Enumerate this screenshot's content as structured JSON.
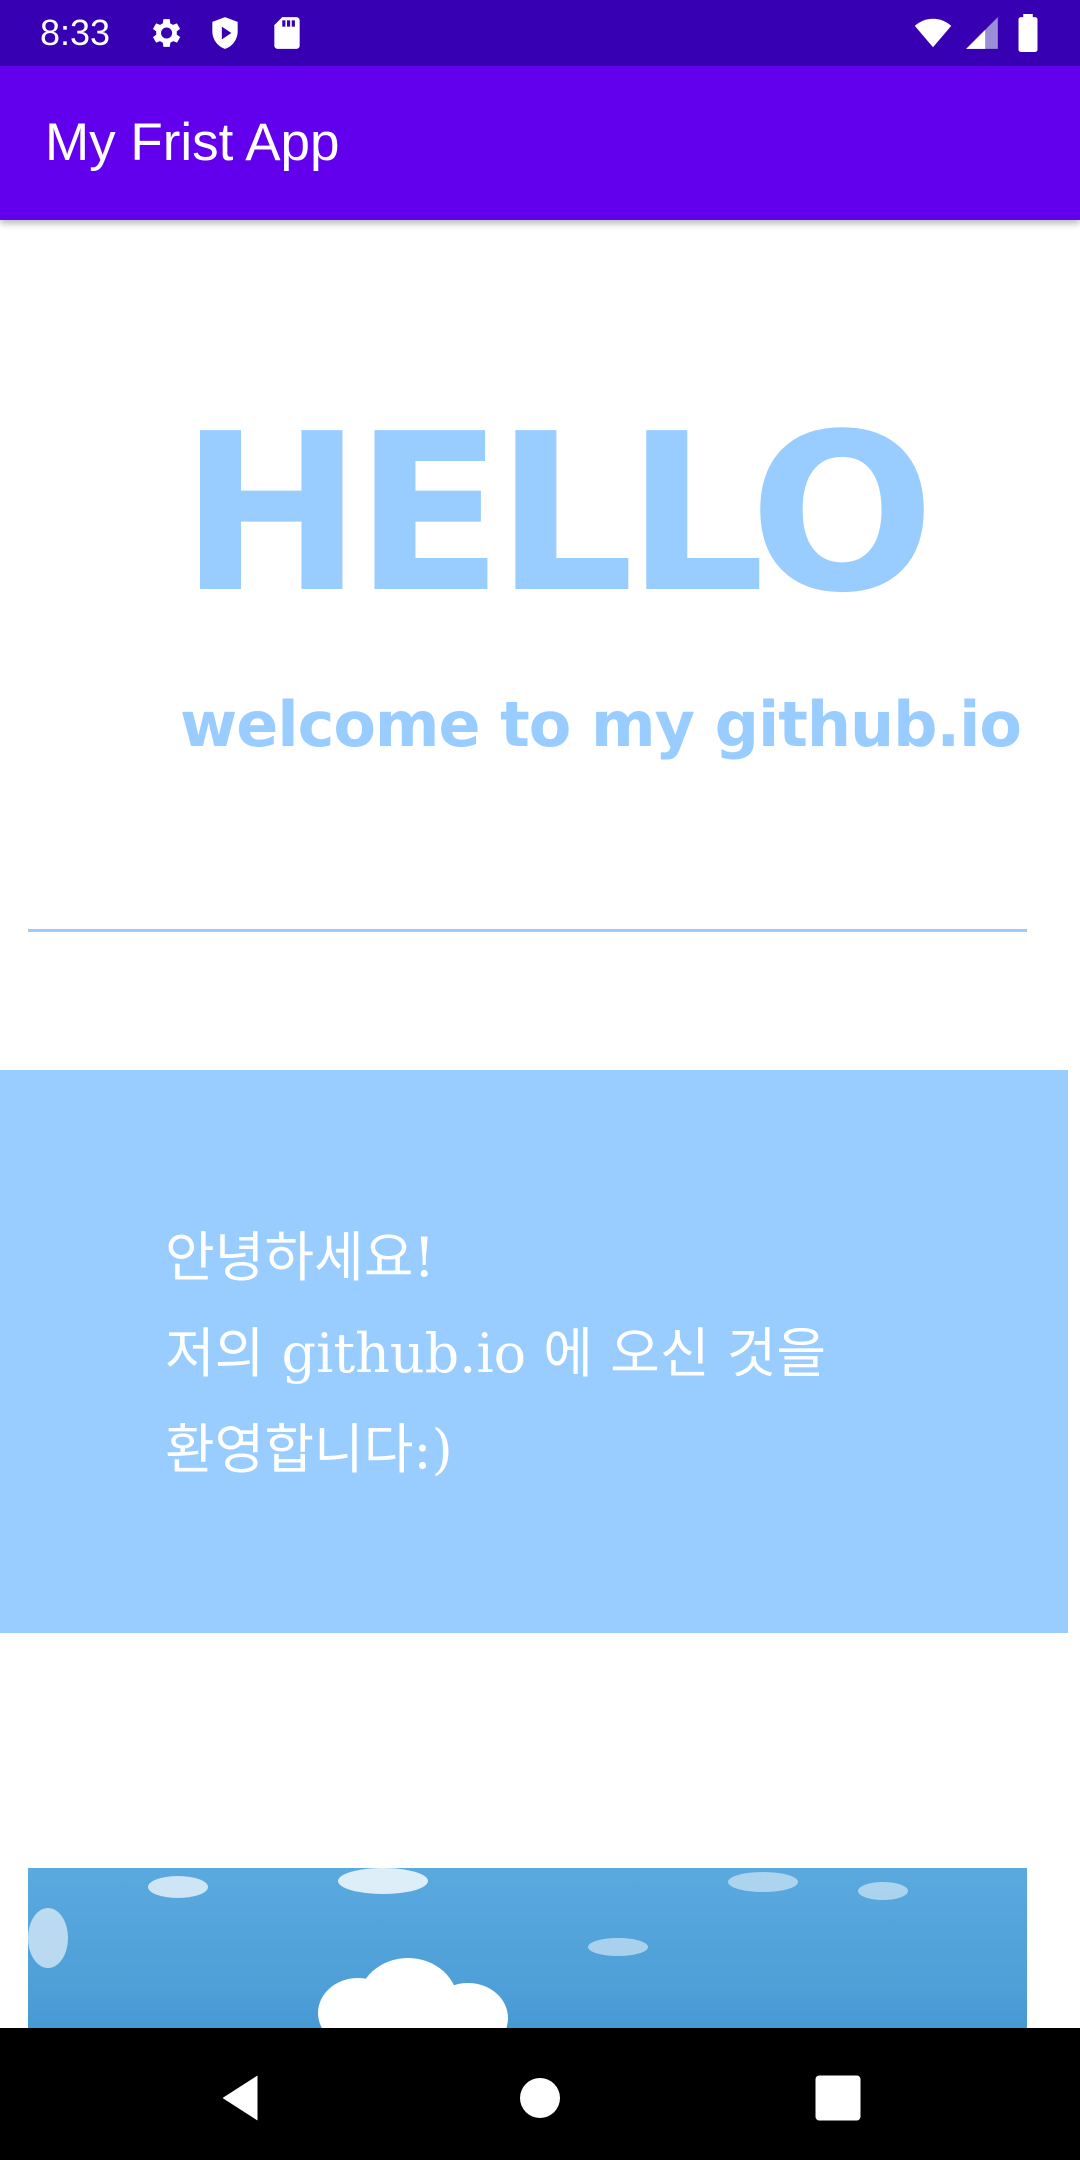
{
  "status_bar": {
    "time": "8:33",
    "left_icons": [
      "settings-icon",
      "shield-icon",
      "sd-card-icon"
    ],
    "right_icons": [
      "wifi-icon",
      "signal-icon",
      "battery-icon"
    ]
  },
  "app_bar": {
    "title": "My Frist App",
    "color": "#6200EE",
    "status_color": "#3700B3"
  },
  "main": {
    "hello": "HELLO",
    "welcome": "welcome to my github.io",
    "accent_color": "#99CCFF",
    "greeting_lines": [
      "안녕하세요!",
      "저의 github.io 에 오신 것을",
      "환영합니다:)"
    ]
  },
  "nav_bar": {
    "buttons": [
      "back-icon",
      "home-icon",
      "recents-icon"
    ]
  }
}
